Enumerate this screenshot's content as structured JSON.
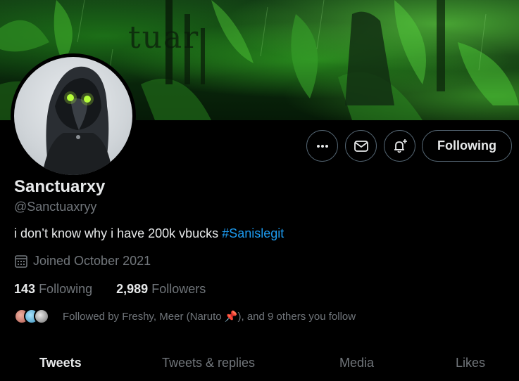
{
  "banner": {
    "text": "tuar"
  },
  "profile": {
    "name": "Sanctuarxy",
    "handle": "@Sanctuaxryy",
    "bio_text": "i don’t know why i have 200k vbucks",
    "bio_hashtag": "#Sanislegit",
    "joined": "Joined October 2021",
    "following_count": "143",
    "following_label": "Following",
    "followers_count": "2,989",
    "followers_label": "Followers",
    "followed_by_prefix": "Followed by Freshy, Meer (Naruto",
    "followed_by_emoji": "📌",
    "followed_by_suffix": "), and 9 others you follow"
  },
  "actions": {
    "more_icon": "more-icon",
    "message_icon": "mail-icon",
    "notify_icon": "bell-plus-icon",
    "follow_label": "Following"
  },
  "tabs": [
    {
      "label": "Tweets",
      "active": true
    },
    {
      "label": "Tweets & replies",
      "active": false
    },
    {
      "label": "Media",
      "active": false
    },
    {
      "label": "Likes",
      "active": false
    }
  ],
  "colors": {
    "background": "#000000",
    "primary_text": "#e7e9ea",
    "secondary_text": "#71767b",
    "link": "#1d9bf0",
    "button_border": "#536471"
  }
}
